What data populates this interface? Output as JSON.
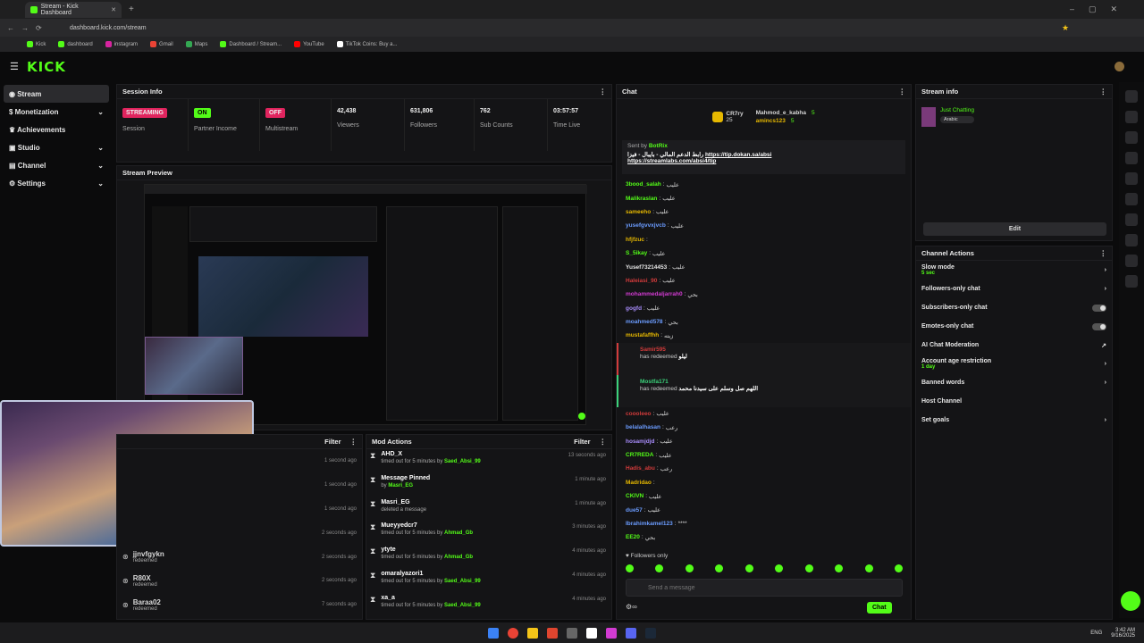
{
  "browser": {
    "tab_title": "Stream - Kick Dashboard",
    "url": "dashboard.kick.com/stream",
    "bookmarks": [
      "Kick",
      "dashboard",
      "instagram",
      "Gmail",
      "Maps",
      "Dashboard / Stream...",
      "YouTube",
      "TikTok Coins: Buy a..."
    ]
  },
  "header": {
    "logo": "KICK"
  },
  "sidebar": {
    "items": [
      {
        "label": "Stream",
        "icon": "broadcast-icon"
      },
      {
        "label": "Monetization",
        "icon": "dollar-icon"
      },
      {
        "label": "Achievements",
        "icon": "trophy-icon"
      },
      {
        "label": "Studio",
        "icon": "studio-icon"
      },
      {
        "label": "Channel",
        "icon": "channel-icon"
      },
      {
        "label": "Settings",
        "icon": "gear-icon"
      }
    ]
  },
  "session_info": {
    "title": "Session Info",
    "stats": [
      {
        "value": "STREAMING",
        "label": "Session"
      },
      {
        "value": "ON",
        "label": "Partner Income"
      },
      {
        "value": "OFF",
        "label": "Multistream"
      },
      {
        "value": "42,438",
        "label": "Viewers"
      },
      {
        "value": "631,806",
        "label": "Followers"
      },
      {
        "value": "762",
        "label": "Sub Counts"
      },
      {
        "value": "03:57:57",
        "label": "Time Live"
      }
    ]
  },
  "stream_preview": {
    "title": "Stream Preview"
  },
  "activity": {
    "filter_label": "Filter",
    "items": [
      {
        "user": "",
        "desc": "",
        "time": "1 second ago"
      },
      {
        "user": "",
        "desc": "",
        "time": "1 second ago"
      },
      {
        "user": "",
        "desc": "",
        "time": "1 second ago"
      },
      {
        "user": "",
        "desc": "",
        "time": "2 seconds ago"
      },
      {
        "user": "jjnvfgykn",
        "desc": "redeemed",
        "time": "2 seconds ago"
      },
      {
        "user": "R80X",
        "desc": "redeemed",
        "time": "2 seconds ago"
      },
      {
        "user": "Baraa02",
        "desc": "redeemed",
        "time": "7 seconds ago"
      }
    ]
  },
  "mod_actions": {
    "title": "Mod Actions",
    "filter_label": "Filter",
    "items": [
      {
        "title": "AHD_X",
        "desc": "timed out for 5 minutes by",
        "by": "Saed_Absi_99",
        "time": "13 seconds ago"
      },
      {
        "title": "Message Pinned",
        "desc": "by",
        "by": "Masri_EG",
        "time": "1 minute ago"
      },
      {
        "title": "Masri_EG",
        "desc": "deleted a message",
        "by": "",
        "time": "1 minute ago"
      },
      {
        "title": "Mueyyedcr7",
        "desc": "timed out for 5 minutes by",
        "by": "Ahmad_Gb",
        "time": "3 minutes ago"
      },
      {
        "title": "ytyte",
        "desc": "timed out for 5 minutes by",
        "by": "Ahmad_Gb",
        "time": "4 minutes ago"
      },
      {
        "title": "omaralyazori1",
        "desc": "timed out for 5 minutes by",
        "by": "Saed_Absi_99",
        "time": "4 minutes ago"
      },
      {
        "title": "xa_a",
        "desc": "timed out for 5 minutes by",
        "by": "Saed_Absi_99",
        "time": "4 minutes ago"
      }
    ]
  },
  "chat": {
    "title": "Chat",
    "top_users": [
      {
        "name": "CR7ry",
        "count": "25"
      },
      {
        "name": "Mahmod_e_kabha",
        "count": "5"
      },
      {
        "name": "amincs123",
        "count": "5"
      }
    ],
    "pinned": {
      "sent_by_label": "Sent by",
      "sender": "BotRix",
      "text": "رابط الدعم المالي - بايبال - فيزا",
      "link1": "https://tip.dokan.sa/absi",
      "link2": "https://streamlabs.com/absi4/tip"
    },
    "messages": [
      {
        "user": "3bood_salah",
        "text": "عليب",
        "color": "#53fc18"
      },
      {
        "user": "Malikraslan",
        "text": "عليب",
        "color": "#53fc18"
      },
      {
        "user": "sameeho",
        "text": "عليب",
        "color": "#e6b800"
      },
      {
        "user": "yusefgvvxjvcb",
        "text": "عليب",
        "color": "#6b9cff"
      },
      {
        "user": "hfjfzuc",
        "text": "",
        "color": "#e6b800"
      },
      {
        "user": "S_5ikay",
        "text": "عليب",
        "color": "#53fc18"
      },
      {
        "user": "Yusef73214453",
        "text": "عليب",
        "color": "#e6e6e6"
      },
      {
        "user": "Haleiasi_90",
        "text": "عليب",
        "color": "#d23b3b"
      },
      {
        "user": "mohammedaljarrah0",
        "text": "بحي",
        "color": "#d23bd2"
      },
      {
        "user": "gogfd",
        "text": "عليب",
        "color": "#a78bfa"
      },
      {
        "user": "moahmed578",
        "text": "بحي",
        "color": "#6b9cff"
      },
      {
        "user": "mustafaffhh",
        "text": "زيته",
        "color": "#e6b800"
      }
    ],
    "redeems": [
      {
        "user": "Samir595",
        "desc": "has redeemed",
        "reward": "ليلو",
        "color": "#d23b3b"
      },
      {
        "user": "Mostfa171",
        "desc": "has redeemed",
        "reward": "اللهم صل وسلم على سيدنا محمد",
        "color": "#3bd27a"
      }
    ],
    "messages2": [
      {
        "user": "coooleeo",
        "text": "عليب",
        "color": "#d23b3b"
      },
      {
        "user": "belalalhasan",
        "text": "رعب",
        "color": "#6b9cff"
      },
      {
        "user": "hosamjdjd",
        "text": "عليب",
        "color": "#a78bfa"
      },
      {
        "user": "CR7REDA",
        "text": "عليب",
        "color": "#53fc18"
      },
      {
        "user": "Hadis_abu",
        "text": "رعب",
        "color": "#d23b3b"
      },
      {
        "user": "Madridao",
        "text": "",
        "color": "#e6b800"
      },
      {
        "user": "CKIVN",
        "text": "عليب",
        "color": "#53fc18"
      },
      {
        "user": "due57",
        "text": "عليب",
        "color": "#6b9cff"
      },
      {
        "user": "Ibrahimkamel123",
        "text": "****",
        "color": "#6b9cff"
      },
      {
        "user": "EE20",
        "text": "بحي",
        "color": "#53fc18"
      }
    ],
    "followers_only": "Followers only",
    "placeholder": "Send a message",
    "send_label": "Chat"
  },
  "stream_info": {
    "title": "Stream info",
    "stream_title": "",
    "category": "Just Chatting",
    "tag": "Arabic",
    "edit_label": "Edit"
  },
  "channel_actions": {
    "title": "Channel Actions",
    "items": [
      {
        "label": "Slow mode",
        "sub": "5 sec",
        "control": "chevron"
      },
      {
        "label": "Followers-only chat",
        "sub": "",
        "control": "chevron"
      },
      {
        "label": "Subscribers-only chat",
        "sub": "",
        "control": "toggle"
      },
      {
        "label": "Emotes-only chat",
        "sub": "",
        "control": "toggle"
      },
      {
        "label": "AI Chat Moderation",
        "sub": "",
        "control": "external"
      },
      {
        "label": "Account age restriction",
        "sub": "1 day",
        "control": "chevron"
      },
      {
        "label": "Banned words",
        "sub": "",
        "control": "chevron"
      },
      {
        "label": "Host Channel",
        "sub": "",
        "control": "none"
      },
      {
        "label": "Set goals",
        "sub": "",
        "control": "chevron"
      }
    ]
  },
  "system": {
    "lang": "ENG",
    "time": "3:42 AM",
    "date": "9/16/2025"
  },
  "colors": {
    "accent": "#53fc18",
    "panel": "#141416",
    "streaming": "#e0245e",
    "on": "#53fc18",
    "off": "#e0245e"
  }
}
